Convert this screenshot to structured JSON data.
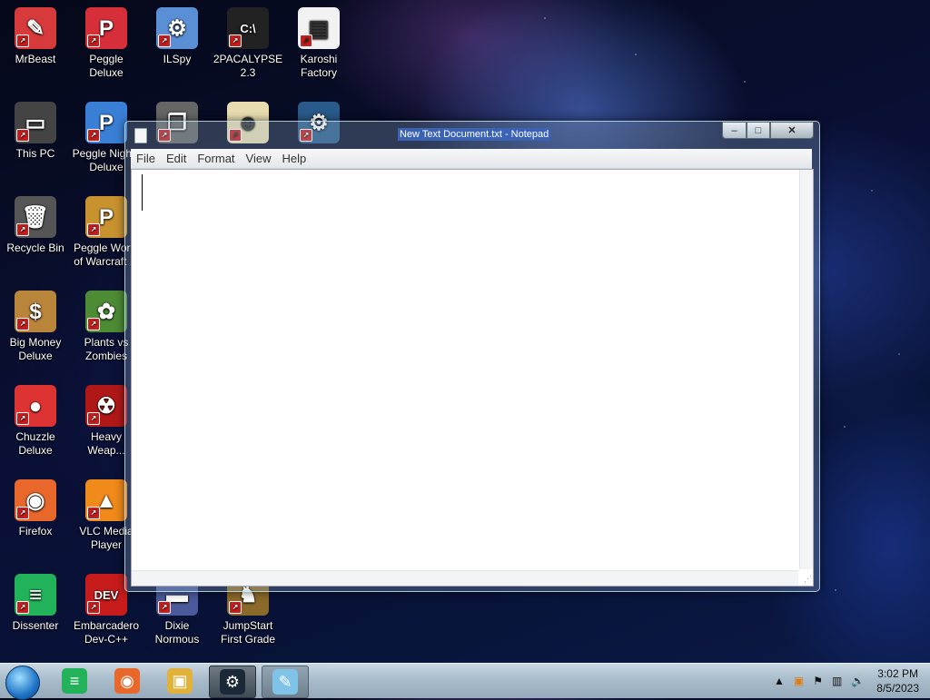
{
  "desktop_icons": [
    {
      "label": "MrBeast",
      "glyph": "✎",
      "color": "#d63a3a"
    },
    {
      "label": "Peggle Deluxe",
      "glyph": "P",
      "color": "#d62f3a"
    },
    {
      "label": "ILSpy",
      "glyph": "⚙",
      "color": "#5a8fd6"
    },
    {
      "label": "2PACALYPSE 2.3",
      "glyph": "C:\\",
      "color": "#222"
    },
    {
      "label": "Karoshi Factory",
      "glyph": "▤",
      "color": "#f2f2f2"
    },
    {
      "label": "This PC",
      "glyph": "▭",
      "color": "#444"
    },
    {
      "label": "Peggle Nights Deluxe",
      "glyph": "P",
      "color": "#3a7fd6"
    },
    {
      "label": "",
      "glyph": "❐",
      "color": "#666"
    },
    {
      "label": "",
      "glyph": "☻",
      "color": "#e8dcb0"
    },
    {
      "label": "",
      "glyph": "⚙",
      "color": "#2a5a8a"
    },
    {
      "label": "Recycle Bin",
      "glyph": "🗑",
      "color": "#555"
    },
    {
      "label": "Peggle World of Warcraft ...",
      "glyph": "P",
      "color": "#c8922f"
    },
    {
      "label": "Big Money Deluxe",
      "glyph": "$",
      "color": "#b9853a"
    },
    {
      "label": "Plants vs Zombies",
      "glyph": "✿",
      "color": "#4d8b35"
    },
    {
      "label": "Chuzzle Deluxe",
      "glyph": "●",
      "color": "#d33"
    },
    {
      "label": "Heavy Weap...",
      "glyph": "☢",
      "color": "#b01818"
    },
    {
      "label": "Firefox",
      "glyph": "◉",
      "color": "#e8672a"
    },
    {
      "label": "VLC Media Player",
      "glyph": "▲",
      "color": "#f08a1a"
    },
    {
      "label": "Dissenter",
      "glyph": "≡",
      "color": "#22b35a"
    },
    {
      "label": "Embarcadero Dev-C++",
      "glyph": "DEV",
      "color": "#c81c1c"
    },
    {
      "label": "Dixie Normous Credit Card ...",
      "glyph": "▬",
      "color": "#4a5a9a"
    },
    {
      "label": "JumpStart First Grade",
      "glyph": "♞",
      "color": "#8a6a2a"
    }
  ],
  "notepad": {
    "title": "New Text Document.txt - Notepad",
    "menu": [
      "File",
      "Edit",
      "Format",
      "View",
      "Help"
    ],
    "content": "",
    "buttons": {
      "minimize": "–",
      "maximize": "□",
      "close": "✕"
    }
  },
  "taskbar": {
    "pinned": [
      {
        "name": "dissenter",
        "glyph": "≡",
        "color": "#22b35a"
      },
      {
        "name": "firefox",
        "glyph": "◉",
        "color": "#e8672a"
      },
      {
        "name": "file-explorer",
        "glyph": "▣",
        "color": "#e0b23a"
      },
      {
        "name": "steam",
        "glyph": "⚙",
        "color": "#1b2838"
      },
      {
        "name": "notepad",
        "glyph": "✎",
        "color": "#7fc3e8"
      }
    ],
    "clock": {
      "time": "3:02 PM",
      "date": "8/5/2023"
    }
  }
}
